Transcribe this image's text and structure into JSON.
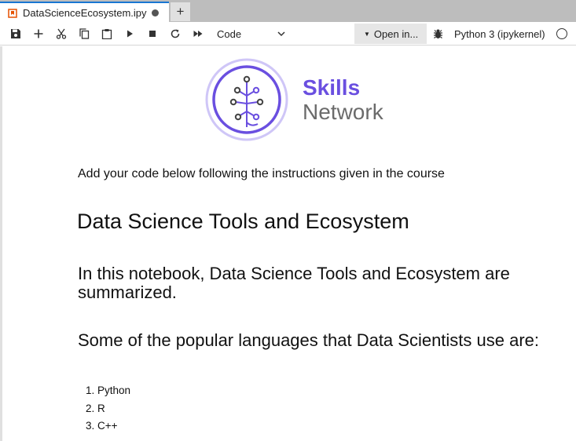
{
  "tab": {
    "label": "DataScienceEcosystem.ipy",
    "new_tab_label": "+"
  },
  "toolbar": {
    "cell_type": "Code",
    "open_in_label": "Open in...",
    "kernel_name": "Python 3 (ipykernel)",
    "icons": [
      "save-icon",
      "add-cell-icon",
      "cut-icon",
      "copy-icon",
      "paste-icon",
      "run-icon",
      "stop-icon",
      "restart-icon",
      "fast-forward-icon"
    ]
  },
  "notebook": {
    "logo": {
      "line1": "Skills",
      "line2": "Network",
      "brand_color": "#6a4fe0"
    },
    "instruction": "Add your code below following the instructions given in the course",
    "title": "Data Science Tools and Ecosystem",
    "intro": "In this notebook, Data Science Tools and Ecosystem are summarized.",
    "languages_heading": "Some of the popular languages that Data Scientists use are:",
    "languages": [
      "Python",
      "R",
      "C++"
    ]
  }
}
